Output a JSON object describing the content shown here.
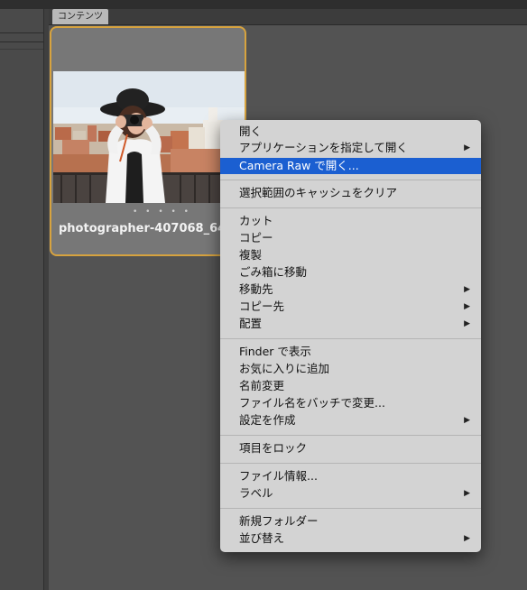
{
  "tabs": {
    "contents": "コンテンツ"
  },
  "thumbnail": {
    "filename": "photographer-407068_640.",
    "dots": "• • • • •"
  },
  "context_menu": {
    "items": [
      {
        "label": "開く",
        "submenu": false
      },
      {
        "label": "アプリケーションを指定して開く",
        "submenu": true
      },
      {
        "label": "Camera Raw で開く...",
        "submenu": false,
        "highlighted": true
      },
      {
        "label": "選択範囲のキャッシュをクリア",
        "submenu": false
      },
      {
        "label": "カット",
        "submenu": false
      },
      {
        "label": "コピー",
        "submenu": false
      },
      {
        "label": "複製",
        "submenu": false
      },
      {
        "label": "ごみ箱に移動",
        "submenu": false
      },
      {
        "label": "移動先",
        "submenu": true
      },
      {
        "label": "コピー先",
        "submenu": true
      },
      {
        "label": "配置",
        "submenu": true
      },
      {
        "label": "Finder で表示",
        "submenu": false
      },
      {
        "label": "お気に入りに追加",
        "submenu": false
      },
      {
        "label": "名前変更",
        "submenu": false
      },
      {
        "label": "ファイル名をバッチで変更...",
        "submenu": false
      },
      {
        "label": "設定を作成",
        "submenu": true
      },
      {
        "label": "項目をロック",
        "submenu": false
      },
      {
        "label": "ファイル情報...",
        "submenu": false
      },
      {
        "label": "ラベル",
        "submenu": true
      },
      {
        "label": "新規フォルダー",
        "submenu": false
      },
      {
        "label": "並び替え",
        "submenu": true
      }
    ],
    "submenu_arrow": "▶"
  },
  "colors": {
    "selection_border": "#d7a33f",
    "menu_highlight": "#1b5fd1"
  }
}
